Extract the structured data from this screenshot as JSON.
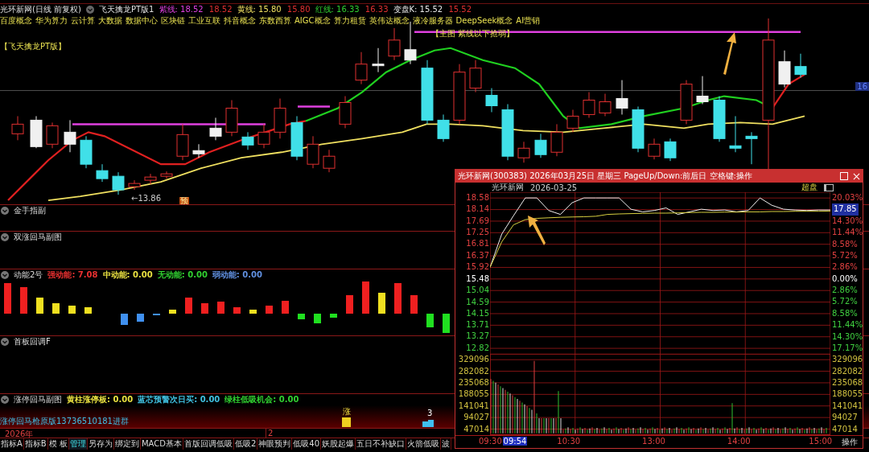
{
  "main_chart": {
    "stock": "光环新网(日线 前复权)",
    "indicator": "飞天擒龙PT版1",
    "legend": [
      {
        "label": "紫线:",
        "values": [
          "18.52",
          "18.52"
        ],
        "color": "#e040e0"
      },
      {
        "label": "黄线:",
        "values": [
          "15.80",
          "15.80"
        ],
        "color": "#f0e060"
      },
      {
        "label": "红线:",
        "values": [
          "16.33",
          "16.33"
        ],
        "color": "#30d030"
      },
      {
        "label": "变盘K:",
        "values": [
          "15.52",
          "15.52"
        ],
        "color": "#e8e8e8"
      }
    ],
    "concepts": [
      "百度概念",
      "华为算力",
      "云计算",
      "大数据",
      "数据中心",
      "区块链",
      "工业互联",
      "抖音概念",
      "东数西算",
      "AIGC概念",
      "算力租赁",
      "英伟达概念",
      "液冷服务器",
      "DeepSeek概念",
      "AI营销"
    ],
    "tag": "【飞天擒龙PT版】",
    "signal_label": "【主图 紫线以下抢弱】",
    "price_tag": "16",
    "low_label": "←13.86",
    "marker": "预"
  },
  "panels": [
    {
      "title": "金手指副",
      "kind": "plain"
    },
    {
      "title": "双涨回马副图",
      "kind": "plain"
    },
    {
      "title": "动能2号",
      "kind": "momentum",
      "legend": [
        {
          "label": "强动能:",
          "value": "7.08",
          "color": "#e83030"
        },
        {
          "label": "中动能:",
          "value": "0.00",
          "color": "#e8e040"
        },
        {
          "label": "无动能:",
          "value": "0.00",
          "color": "#30d030"
        },
        {
          "label": "弱动能:",
          "value": "0.00",
          "color": "#6090e0"
        }
      ]
    },
    {
      "title": "首板回调F",
      "kind": "plain"
    },
    {
      "title": "涨停回马副图",
      "kind": "limit",
      "legend": [
        {
          "label": "黄柱涨停板:",
          "value": "0.00",
          "color": "#e8e040"
        },
        {
          "label": "蓝芯预警次日买:",
          "value": "0.00",
          "color": "#40c0e0"
        },
        {
          "label": "绿柱低吸机会:",
          "value": "0.00",
          "color": "#30d030"
        }
      ],
      "note": "涨停回马枪原版13736510181进群",
      "markers": [
        "涨",
        "3"
      ]
    }
  ],
  "date_axis": [
    "2026年",
    "2"
  ],
  "tabs": [
    {
      "label": "指标A",
      "selected": false
    },
    {
      "label": "指标B",
      "selected": false
    },
    {
      "label": "模 板",
      "selected": false
    },
    {
      "label": "管理",
      "selected": true
    },
    {
      "label": "另存为",
      "selected": false
    },
    {
      "label": "绑定到",
      "selected": false
    },
    {
      "label": "MACD基本",
      "selected": false
    },
    {
      "label": "首版回调低吸",
      "selected": false
    },
    {
      "label": "低吸2",
      "selected": false
    },
    {
      "label": "神眼预判",
      "selected": false
    },
    {
      "label": "低吸40",
      "selected": false
    },
    {
      "label": "妖股起爆",
      "selected": false
    },
    {
      "label": "五日不补缺口",
      "selected": false
    },
    {
      "label": "火箭低吸",
      "selected": false
    },
    {
      "label": "波",
      "selected": false
    }
  ],
  "popup": {
    "title": "光环新网(300383) 2026年03月25日 星期三 PageUp/Down:前后日 空格键:操作",
    "stock": "光环新网",
    "date": "2026-03-25",
    "mode": "超盘",
    "left_axis": [
      {
        "text": "329096",
        "kind": "volume"
      },
      {
        "text": "282082",
        "kind": "volume"
      },
      {
        "text": "235068",
        "kind": "volume"
      },
      {
        "text": "188055",
        "kind": "volume"
      },
      {
        "text": "141041",
        "kind": "volume"
      },
      {
        "text": "94027",
        "kind": "volume"
      },
      {
        "text": "47014",
        "kind": "volume"
      }
    ],
    "right_axis": [
      {
        "text": "20.03%",
        "kind": "up"
      },
      {
        "text": "17.85",
        "kind": "current"
      },
      {
        "text": "14.30%",
        "kind": "up"
      },
      {
        "text": "11.44%",
        "kind": "up"
      },
      {
        "text": "8.58%",
        "kind": "up"
      },
      {
        "text": "5.72%",
        "kind": "up"
      },
      {
        "text": "2.86%",
        "kind": "up"
      },
      {
        "text": "0.00%",
        "kind": "flat"
      },
      {
        "text": "2.86%",
        "kind": "down"
      },
      {
        "text": "5.72%",
        "kind": "down"
      },
      {
        "text": "8.58%",
        "kind": "down"
      },
      {
        "text": "11.44%",
        "kind": "down"
      },
      {
        "text": "14.30%",
        "kind": "down"
      },
      {
        "text": "17.17%",
        "kind": "down"
      },
      {
        "text": "329096",
        "kind": "volume"
      },
      {
        "text": "282082",
        "kind": "volume"
      },
      {
        "text": "235068",
        "kind": "volume"
      },
      {
        "text": "188055",
        "kind": "volume"
      },
      {
        "text": "141041",
        "kind": "volume"
      },
      {
        "text": "94027",
        "kind": "volume"
      },
      {
        "text": "47014",
        "kind": "volume"
      }
    ],
    "times": [
      {
        "text": "09:30",
        "selected": false
      },
      {
        "text": "09:54",
        "selected": true
      },
      {
        "text": "10:30",
        "selected": false
      },
      {
        "text": "13:00",
        "selected": false
      },
      {
        "text": "14:00",
        "selected": false
      },
      {
        "text": "15:00",
        "selected": false
      }
    ],
    "action": "操作",
    "chart_data": {
      "type": "line",
      "ylim": [
        12.6,
        18.8
      ],
      "grid": true,
      "yticks": [
        {
          "value": 18.58,
          "label": "18.58"
        },
        {
          "value": 18.14,
          "label": "18.14"
        },
        {
          "value": 17.69,
          "label": "17.69"
        },
        {
          "value": 17.25,
          "label": "17.25"
        },
        {
          "value": 16.81,
          "label": "16.81"
        },
        {
          "value": 16.37,
          "label": "16.37"
        },
        {
          "value": 15.92,
          "label": "15.92"
        },
        {
          "value": 15.48,
          "label": "15.48"
        },
        {
          "value": 15.04,
          "label": "15.04"
        },
        {
          "value": 14.59,
          "label": "14.59"
        },
        {
          "value": 14.15,
          "label": "14.15"
        },
        {
          "value": 13.71,
          "label": "13.71"
        },
        {
          "value": 13.27,
          "label": "13.27"
        },
        {
          "value": 12.82,
          "label": "12.82"
        }
      ],
      "series": [
        {
          "color": "#f0f0f0",
          "values": [
            15.92,
            17.2,
            17.9,
            18.58,
            18.58,
            18.1,
            17.95,
            18.4,
            18.58,
            18.58,
            18.58,
            18.58,
            18.15,
            18.05,
            18.1,
            18.2,
            17.95,
            18.05,
            18.15,
            18.1,
            18.12,
            18.05,
            18.1,
            18.58,
            18.3,
            18.15,
            18.12,
            18.1,
            18.12,
            18.12
          ]
        },
        {
          "color": "#d8d040",
          "values": [
            15.92,
            16.9,
            17.55,
            17.75,
            17.8,
            17.82,
            17.84,
            17.85,
            17.86,
            17.88,
            17.95,
            17.97,
            17.98,
            17.99,
            18.0,
            18.0,
            18.01,
            18.02,
            18.03,
            18.03,
            18.04,
            18.04,
            18.05,
            18.05,
            18.06,
            18.06,
            18.07,
            18.07,
            18.07,
            18.08
          ]
        }
      ]
    }
  }
}
